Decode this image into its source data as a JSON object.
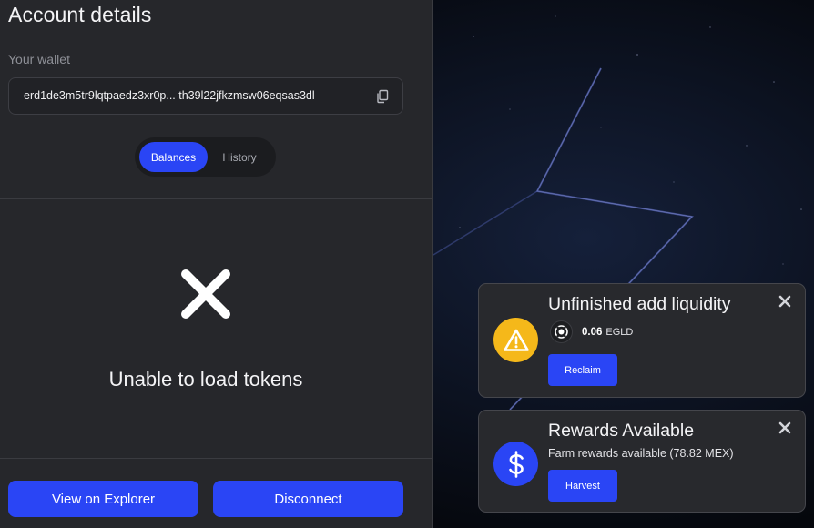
{
  "account": {
    "title": "Account details",
    "wallet_label": "Your wallet",
    "wallet_address": "erd1de3m5tr9lqtpaedz3xr0p... th39l22jfkzmsw06eqsas3dl",
    "tabs": [
      {
        "label": "Balances",
        "active": true
      },
      {
        "label": "History",
        "active": false
      }
    ],
    "error_message": "Unable to load tokens",
    "buttons": {
      "explorer": "View on Explorer",
      "disconnect": "Disconnect"
    }
  },
  "notifications": [
    {
      "title": "Unfinished add liquidity",
      "icon": "warning-icon",
      "amount": "0.06",
      "token": "EGLD",
      "action_label": "Reclaim"
    },
    {
      "title": "Rewards Available",
      "icon": "dollar-icon",
      "message": "Farm rewards available (78.82 MEX)",
      "action_label": "Harvest"
    }
  ],
  "colors": {
    "accent": "#2a45f5",
    "warning": "#f5b81a",
    "panel": "#26272b",
    "card": "#28292d"
  }
}
